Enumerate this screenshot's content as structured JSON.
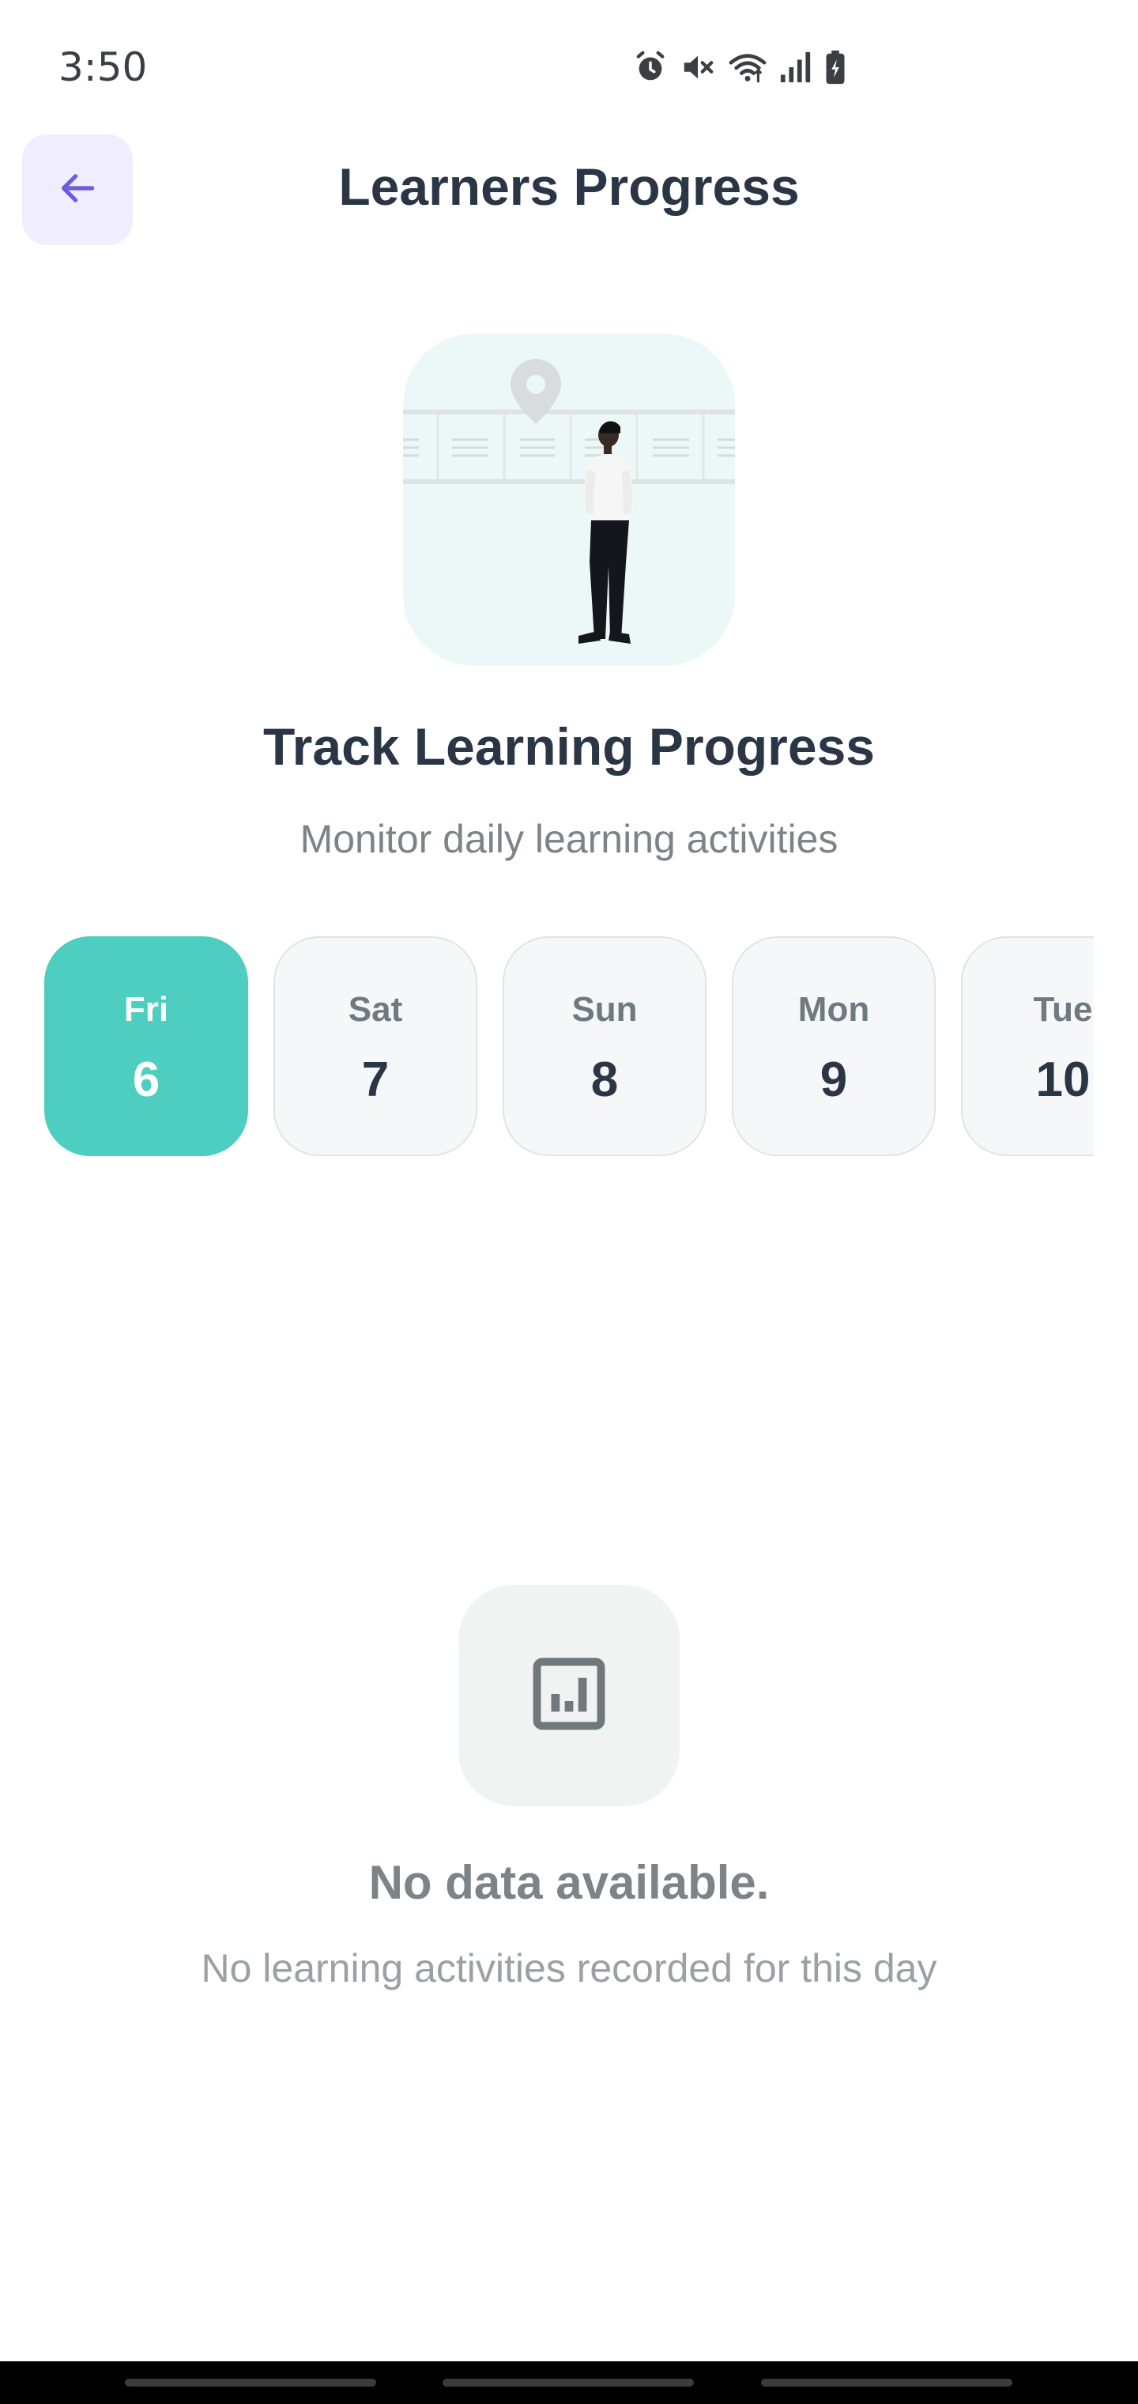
{
  "status_bar": {
    "time": "3:50",
    "icons": [
      "alarm-icon",
      "mute-icon",
      "wifi-icon",
      "signal-icon",
      "battery-icon"
    ]
  },
  "header": {
    "title": "Learners Progress",
    "back_icon": "arrow-left-icon"
  },
  "hero": {
    "illustration": "person-at-map-illustration",
    "title": "Track Learning Progress",
    "subtitle": "Monitor daily learning activities"
  },
  "days": [
    {
      "name": "Fri",
      "num": "6",
      "selected": true
    },
    {
      "name": "Sat",
      "num": "7",
      "selected": false
    },
    {
      "name": "Sun",
      "num": "8",
      "selected": false
    },
    {
      "name": "Mon",
      "num": "9",
      "selected": false
    },
    {
      "name": "Tue",
      "num": "10",
      "selected": false
    }
  ],
  "empty_state": {
    "icon": "bar-chart-icon",
    "title": "No data available.",
    "subtitle": "No learning activities recorded for this day"
  },
  "colors": {
    "accent": "#4ecdc1",
    "back_button_bg": "#efedfe",
    "back_arrow": "#6b5ce0",
    "text_dark": "#2a3546",
    "text_muted": "#7c8488"
  }
}
